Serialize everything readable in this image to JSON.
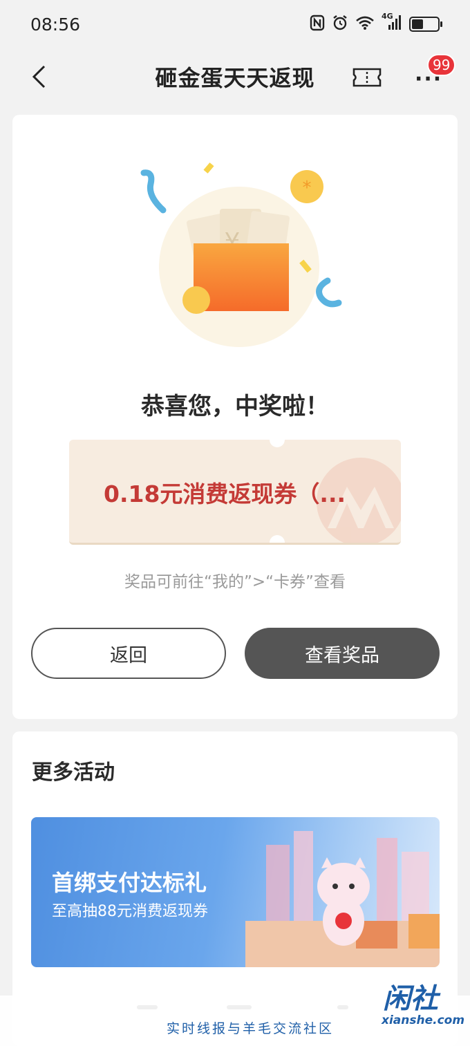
{
  "status_bar": {
    "time": "08:56",
    "network": "4G"
  },
  "nav": {
    "title": "砸金蛋天天返现",
    "badge": "99"
  },
  "result": {
    "congrats": "恭喜您，中奖啦！",
    "prize": "0.18元消费返现券（...",
    "hint": "奖品可前往“我的”>“卡券”查看",
    "back_button": "返回",
    "view_button": "查看奖品"
  },
  "more": {
    "title": "更多活动",
    "banner": {
      "title": "首绑支付达标礼",
      "subtitle": "至高抽88元消费返现券"
    }
  },
  "watermark": {
    "logo": "闲社",
    "site": "xianshe.com",
    "tagline": "实时线报与羊毛交流社区"
  },
  "colors": {
    "accent_red": "#c43a36",
    "badge_red": "#e8343a",
    "dark_button": "#555555",
    "banner_blue": "#4f8fe0",
    "watermark_blue": "#1f5fa8"
  }
}
